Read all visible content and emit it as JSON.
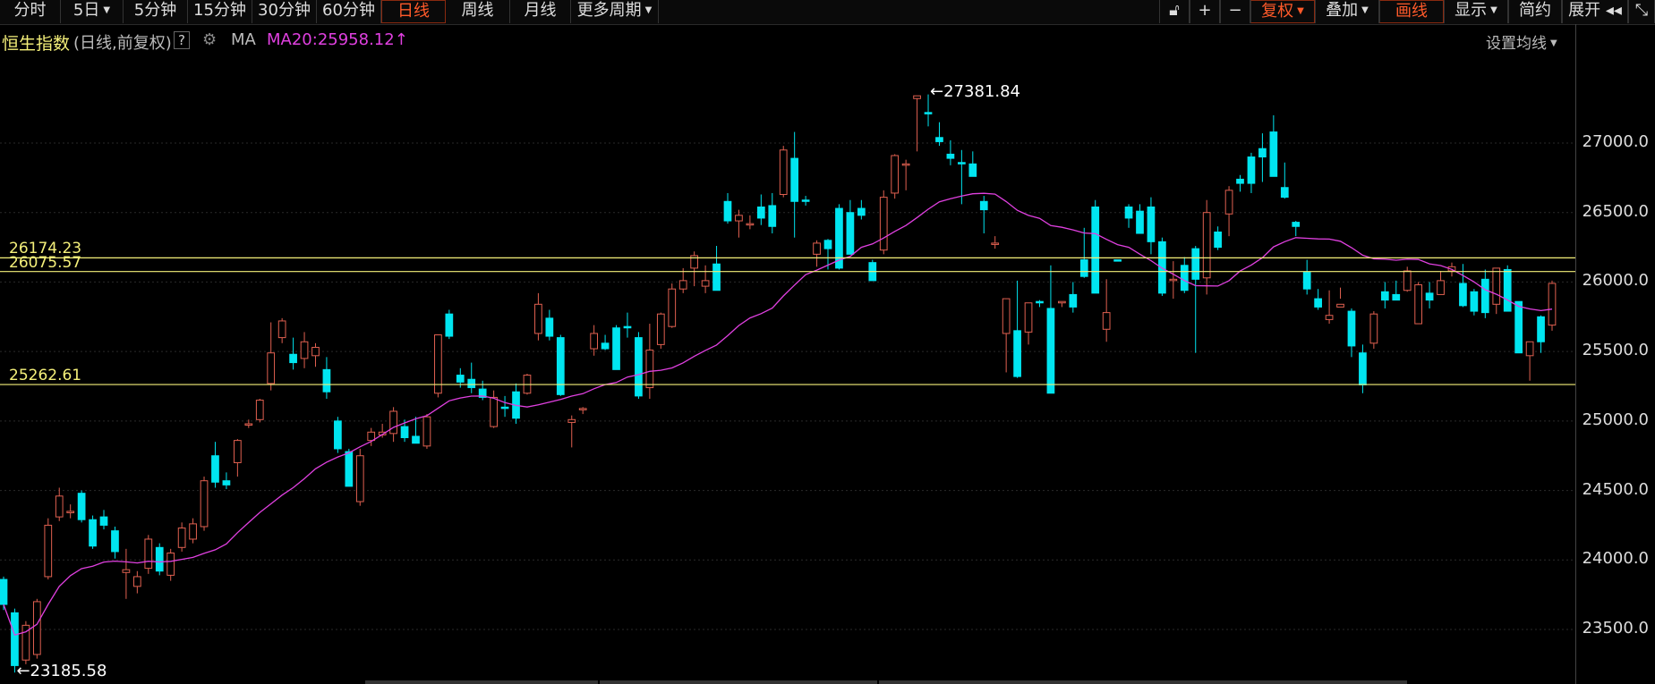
{
  "toolbar": {
    "periods": [
      {
        "label": "分时"
      },
      {
        "label": "5日",
        "caret": true
      },
      {
        "label": "5分钟"
      },
      {
        "label": "15分钟"
      },
      {
        "label": "30分钟"
      },
      {
        "label": "60分钟"
      },
      {
        "label": "日线",
        "active": true
      },
      {
        "label": "周线"
      },
      {
        "label": "月线"
      },
      {
        "label": "更多周期",
        "caret": true
      }
    ],
    "right": [
      {
        "label": "🔓︎",
        "name": "lock-icon"
      },
      {
        "label": "+",
        "name": "zoom-in-button"
      },
      {
        "label": "−",
        "name": "zoom-out-button"
      },
      {
        "label": "复权",
        "caret": true,
        "active": true,
        "name": "adjust-button"
      },
      {
        "label": "叠加",
        "caret": true,
        "name": "overlay-button"
      },
      {
        "label": "画线",
        "active": true,
        "name": "draw-line-button"
      },
      {
        "label": "显示",
        "caret": true,
        "name": "display-button"
      },
      {
        "label": "简约",
        "name": "simple-button"
      },
      {
        "label": "展开 ◂◂",
        "name": "expand-button"
      },
      {
        "label": "⤡",
        "name": "fullscreen-icon"
      }
    ]
  },
  "info": {
    "name": "恒生指数",
    "mode": "(日线,前复权)",
    "help": "?",
    "ma_label": "MA",
    "ma20": "MA20:25958.12",
    "ma20_arrow": "↑",
    "settings": "设置均线",
    "colors": {
      "name": "#f5f07a",
      "ma": "#e040e0",
      "up": "#e06050",
      "down": "#00e5f0"
    }
  },
  "chart_data": {
    "type": "candlestick",
    "ylim": [
      23100,
      27520
    ],
    "yticks": [
      23500,
      24000,
      24500,
      25000,
      25500,
      26000,
      26500,
      27000
    ],
    "ytick_labels": [
      "23500.0",
      "24000.0",
      "24500.0",
      "25000.0",
      "25500.0",
      "26000.0",
      "26500.0",
      "27000.0"
    ],
    "hlines": [
      {
        "value": 26174.23,
        "label": "26174.23"
      },
      {
        "value": 26075.57,
        "label": "26075.57"
      },
      {
        "value": 25262.61,
        "label": "25262.61"
      }
    ],
    "high_label": "←27381.84",
    "low_label": "←23185.58",
    "ohlc": [
      [
        23860,
        23880,
        23640,
        23680
      ],
      [
        23620,
        23650,
        23190,
        23240
      ],
      [
        23280,
        23560,
        23250,
        23530
      ],
      [
        23320,
        23720,
        23290,
        23700
      ],
      [
        23880,
        24300,
        23860,
        24250
      ],
      [
        24310,
        24520,
        24280,
        24460
      ],
      [
        24340,
        24400,
        24300,
        24350
      ],
      [
        24480,
        24500,
        24270,
        24290
      ],
      [
        24290,
        24320,
        24080,
        24100
      ],
      [
        24310,
        24360,
        24220,
        24250
      ],
      [
        24210,
        24240,
        24010,
        24060
      ],
      [
        23910,
        24080,
        23720,
        23930
      ],
      [
        23810,
        23920,
        23760,
        23880
      ],
      [
        23940,
        24180,
        23900,
        24150
      ],
      [
        24090,
        24120,
        23890,
        23920
      ],
      [
        23890,
        24080,
        23850,
        24050
      ],
      [
        24090,
        24270,
        24060,
        24230
      ],
      [
        24150,
        24300,
        24120,
        24260
      ],
      [
        24240,
        24600,
        24210,
        24570
      ],
      [
        24750,
        24850,
        24520,
        24560
      ],
      [
        24570,
        24630,
        24510,
        24540
      ],
      [
        24700,
        24870,
        24600,
        24860
      ],
      [
        24980,
        25010,
        24950,
        24980
      ],
      [
        25010,
        25160,
        24990,
        25150
      ],
      [
        25270,
        25710,
        25220,
        25490
      ],
      [
        25600,
        25740,
        25560,
        25720
      ],
      [
        25480,
        25600,
        25370,
        25420
      ],
      [
        25450,
        25640,
        25380,
        25570
      ],
      [
        25470,
        25560,
        25390,
        25530
      ],
      [
        25370,
        25460,
        25160,
        25210
      ],
      [
        25000,
        25030,
        24770,
        24800
      ],
      [
        24780,
        24800,
        24530,
        24530
      ],
      [
        24420,
        24800,
        24390,
        24750
      ],
      [
        24860,
        24950,
        24820,
        24920
      ],
      [
        24900,
        24980,
        24880,
        24920
      ],
      [
        24910,
        25100,
        24850,
        25070
      ],
      [
        24960,
        25010,
        24850,
        24880
      ],
      [
        24890,
        25030,
        24840,
        24840
      ],
      [
        24820,
        25050,
        24800,
        25030
      ],
      [
        25200,
        25620,
        25170,
        25620
      ],
      [
        25770,
        25800,
        25590,
        25610
      ],
      [
        25330,
        25380,
        25240,
        25280
      ],
      [
        25300,
        25420,
        25200,
        25240
      ],
      [
        25230,
        25290,
        25150,
        25170
      ],
      [
        24960,
        25220,
        24950,
        25170
      ],
      [
        25100,
        25180,
        25030,
        25090
      ],
      [
        25210,
        25270,
        24980,
        25020
      ],
      [
        25200,
        25340,
        25190,
        25330
      ],
      [
        25630,
        25920,
        25580,
        25840
      ],
      [
        25740,
        25800,
        25580,
        25610
      ],
      [
        25600,
        25620,
        25180,
        25190
      ],
      [
        24990,
        25040,
        24810,
        25010
      ],
      [
        25090,
        25100,
        25050,
        25090
      ],
      [
        25520,
        25690,
        25470,
        25630
      ],
      [
        25560,
        25620,
        25510,
        25520
      ],
      [
        25670,
        25690,
        25370,
        25370
      ],
      [
        25680,
        25780,
        25600,
        25670
      ],
      [
        25600,
        25640,
        25160,
        25180
      ],
      [
        25240,
        25700,
        25160,
        25510
      ],
      [
        25550,
        25780,
        25520,
        25770
      ],
      [
        25680,
        25990,
        25670,
        25950
      ],
      [
        25950,
        26100,
        25920,
        26010
      ],
      [
        26100,
        26220,
        25970,
        26190
      ],
      [
        25970,
        26120,
        25920,
        26010
      ],
      [
        26130,
        26260,
        25990,
        25940
      ],
      [
        26580,
        26640,
        26420,
        26440
      ],
      [
        26440,
        26520,
        26320,
        26480
      ],
      [
        26420,
        26480,
        26380,
        26420
      ],
      [
        26540,
        26630,
        26410,
        26460
      ],
      [
        26550,
        26640,
        26350,
        26400
      ],
      [
        26630,
        26980,
        26610,
        26950
      ],
      [
        26890,
        27080,
        26320,
        26580
      ],
      [
        26590,
        26620,
        26550,
        26580
      ],
      [
        26200,
        26300,
        26110,
        26280
      ],
      [
        26300,
        26310,
        26090,
        26240
      ],
      [
        26530,
        26560,
        26090,
        26100
      ],
      [
        26500,
        26590,
        26200,
        26200
      ],
      [
        26530,
        26590,
        26450,
        26480
      ],
      [
        26140,
        26160,
        26020,
        26010
      ],
      [
        26230,
        26660,
        26200,
        26610
      ],
      [
        26640,
        26920,
        26600,
        26910
      ],
      [
        26850,
        26880,
        26660,
        26850
      ],
      [
        27320,
        27320,
        26940,
        27340
      ],
      [
        27220,
        27350,
        27120,
        27210
      ],
      [
        27040,
        27150,
        26980,
        27010
      ],
      [
        26920,
        27020,
        26840,
        26890
      ],
      [
        26860,
        26950,
        26560,
        26850
      ],
      [
        26850,
        26940,
        26780,
        26760
      ],
      [
        26580,
        26620,
        26350,
        26520
      ],
      [
        26280,
        26330,
        26240,
        26280
      ],
      [
        25630,
        25880,
        25350,
        25880
      ],
      [
        25650,
        26010,
        25310,
        25320
      ],
      [
        25640,
        25850,
        25550,
        25850
      ],
      [
        25860,
        25870,
        25820,
        25850
      ],
      [
        25810,
        26120,
        25480,
        25200
      ],
      [
        25850,
        25860,
        25820,
        25860
      ],
      [
        25910,
        26000,
        25780,
        25820
      ],
      [
        26160,
        26390,
        26030,
        26040
      ],
      [
        26540,
        26590,
        25960,
        25920
      ],
      [
        25660,
        26020,
        25570,
        25780
      ],
      [
        26160,
        26160,
        26150,
        26150
      ],
      [
        26540,
        26560,
        26390,
        26460
      ],
      [
        26510,
        26560,
        26350,
        26350
      ],
      [
        26540,
        26610,
        26200,
        26290
      ],
      [
        26290,
        26320,
        25900,
        25920
      ],
      [
        26020,
        26150,
        25880,
        26020
      ],
      [
        26120,
        26180,
        25920,
        25940
      ],
      [
        26240,
        26260,
        25490,
        26020
      ],
      [
        26030,
        26590,
        25910,
        26500
      ],
      [
        26360,
        26400,
        26230,
        26250
      ],
      [
        26490,
        26690,
        26330,
        26660
      ],
      [
        26740,
        26770,
        26650,
        26710
      ],
      [
        26900,
        26930,
        26640,
        26710
      ],
      [
        26960,
        27070,
        26720,
        26900
      ],
      [
        27080,
        27200,
        26760,
        26760
      ],
      [
        26680,
        26860,
        26600,
        26610
      ],
      [
        26430,
        26440,
        26330,
        26400
      ],
      [
        26070,
        26160,
        25910,
        25950
      ],
      [
        25880,
        25950,
        25800,
        25820
      ],
      [
        25730,
        25940,
        25700,
        25760
      ],
      [
        25820,
        25960,
        25880,
        25840
      ],
      [
        25790,
        25810,
        25460,
        25540
      ],
      [
        25490,
        25550,
        25200,
        25260
      ],
      [
        25560,
        25790,
        25520,
        25770
      ],
      [
        25930,
        26000,
        25810,
        25870
      ],
      [
        25910,
        26010,
        25870,
        25870
      ],
      [
        25940,
        26110,
        25930,
        26080
      ],
      [
        25700,
        26000,
        25760,
        25980
      ],
      [
        25920,
        26000,
        25810,
        25870
      ],
      [
        25910,
        26080,
        25910,
        26010
      ],
      [
        26080,
        26140,
        26040,
        26110
      ],
      [
        25990,
        26130,
        25820,
        25830
      ],
      [
        25930,
        25950,
        25760,
        25790
      ],
      [
        26020,
        26090,
        25740,
        25780
      ],
      [
        25840,
        26040,
        25770,
        26100
      ],
      [
        26090,
        26120,
        25810,
        25790
      ],
      [
        25860,
        25890,
        25890,
        25490
      ],
      [
        25470,
        25560,
        25290,
        25570
      ],
      [
        25750,
        25760,
        25490,
        25570
      ],
      [
        25690,
        26010,
        25650,
        25990
      ]
    ]
  }
}
